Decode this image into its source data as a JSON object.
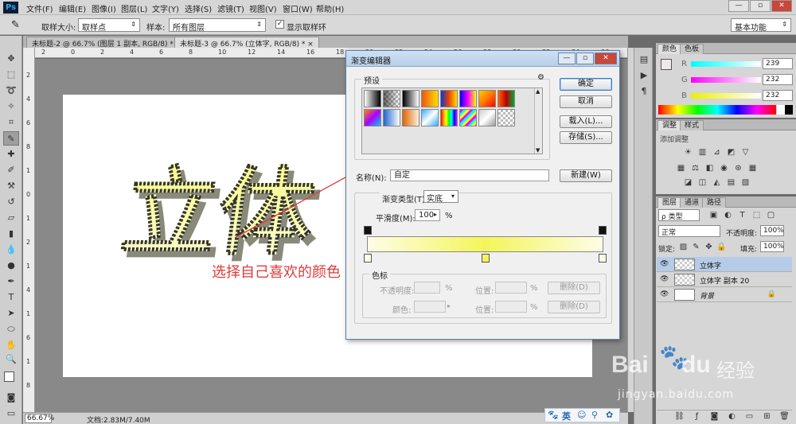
{
  "app": {
    "logo": "Ps",
    "menus": [
      "文件(F)",
      "编辑(E)",
      "图像(I)",
      "图层(L)",
      "文字(Y)",
      "选择(S)",
      "滤镜(T)",
      "视图(V)",
      "窗口(W)",
      "帮助(H)"
    ],
    "window_controls": [
      "—",
      "▫",
      "✕"
    ]
  },
  "options": {
    "sample_size_label": "取样大小:",
    "sample_size_value": "取样点",
    "sample_label": "样本:",
    "sample_value": "所有图层",
    "show_ring_label": "显示取样环",
    "workspace_value": "基本功能"
  },
  "tabs": [
    {
      "label": "未标题-2 @ 66.7% (图层 1 副本, RGB/8) *",
      "close": "×"
    },
    {
      "label": "未标题-3 @ 66.7% (立体字, RGB/8) *",
      "close": "×"
    }
  ],
  "rulers": {
    "h": [
      "2",
      "0",
      "2",
      "4",
      "6",
      "8",
      "10",
      "12",
      "14",
      "16",
      "18",
      "20",
      "22",
      "24",
      "26",
      "28",
      "30",
      "32",
      "34",
      "36"
    ],
    "v": [
      "2",
      "4",
      "6",
      "8",
      "1",
      "0",
      "1",
      "2",
      "1",
      "4",
      "1",
      "6",
      "1",
      "8"
    ]
  },
  "canvas": {
    "artwork_text": "立体",
    "annotation": "选择自己喜欢的颜色"
  },
  "status": {
    "zoom": "66.67%",
    "doc": "文档:2.83M/7.40M"
  },
  "gradient_editor": {
    "title": "渐变编辑器",
    "presets_label": "预设",
    "ok": "确定",
    "cancel": "取消",
    "load": "载入(L)...",
    "save": "存储(S)...",
    "name_label": "名称(N):",
    "name_value": "自定",
    "new_button": "新建(W)",
    "gradient_type_label": "渐变类型(T):",
    "gradient_type_value": "实底",
    "smoothness_label": "平滑度(M):",
    "smoothness_value": "100",
    "smoothness_unit": "%",
    "stops_label": "色标",
    "opacity_label": "不透明度:",
    "color_label": "颜色:",
    "location_label": "位置:",
    "percent": "%",
    "delete_label": "删除(D)",
    "gradient_colors": [
      "#fdfde8",
      "#f4f55a",
      "#fdfde8"
    ],
    "color_stop_midpoint_percent": 50,
    "preset_swatches": [
      "linear-gradient(90deg,#fff,#000)",
      "checker-fade",
      "linear-gradient(90deg,#000,#fff)",
      "linear-gradient(90deg,#e51,#fd0)",
      "linear-gradient(90deg,#13c,#e40,#fd0)",
      "linear-gradient(90deg,#00f,#f0f,#ff0)",
      "linear-gradient(135deg,#fc0,#f70,#f00)",
      "linear-gradient(90deg,#f60,#b00,#0a3)",
      "linear-gradient(135deg,#f80,#a0f,#0cf)",
      "linear-gradient(90deg,#26c,#fff)",
      "linear-gradient(90deg,#d60,#fed)",
      "linear-gradient(135deg,#3af,#fff,#3af)",
      "linear-gradient(90deg,red,orange,yellow,lime,cyan,blue,magenta)",
      "repeating-linear-gradient(135deg,#f0f 0 3px,#0ff 3px 6px,#ff0 6px 9px)",
      "linear-gradient(135deg,#ccc,#fff,#999)",
      "checker"
    ]
  },
  "panels": {
    "color_tabs": [
      "颜色",
      "色板"
    ],
    "r_label": "R",
    "g_label": "G",
    "b_label": "B",
    "r_value": "239",
    "g_value": "232",
    "b_value": "232",
    "adjust_tabs": [
      "调整",
      "样式"
    ],
    "adjust_add": "添加调整",
    "layers_tabs": [
      "图层",
      "通道",
      "路径"
    ],
    "kind_filter": "ρ 类型",
    "blend_mode": "正常",
    "opacity_label": "不透明度:",
    "opacity_value": "100%",
    "lock_label": "锁定:",
    "fill_label": "填充:",
    "fill_value": "100%",
    "layers": [
      {
        "name": "立体字",
        "selected": true
      },
      {
        "name": "立体字 副本 20",
        "selected": false
      },
      {
        "name": "背景",
        "selected": false
      }
    ]
  },
  "ime": {
    "items": [
      "🐾",
      "英",
      "☺",
      "⚲",
      "✿"
    ]
  },
  "watermark": {
    "brand": "Bai",
    "brand2": "du",
    "brand3": "经验",
    "url": "jingyan.baidu.com"
  }
}
